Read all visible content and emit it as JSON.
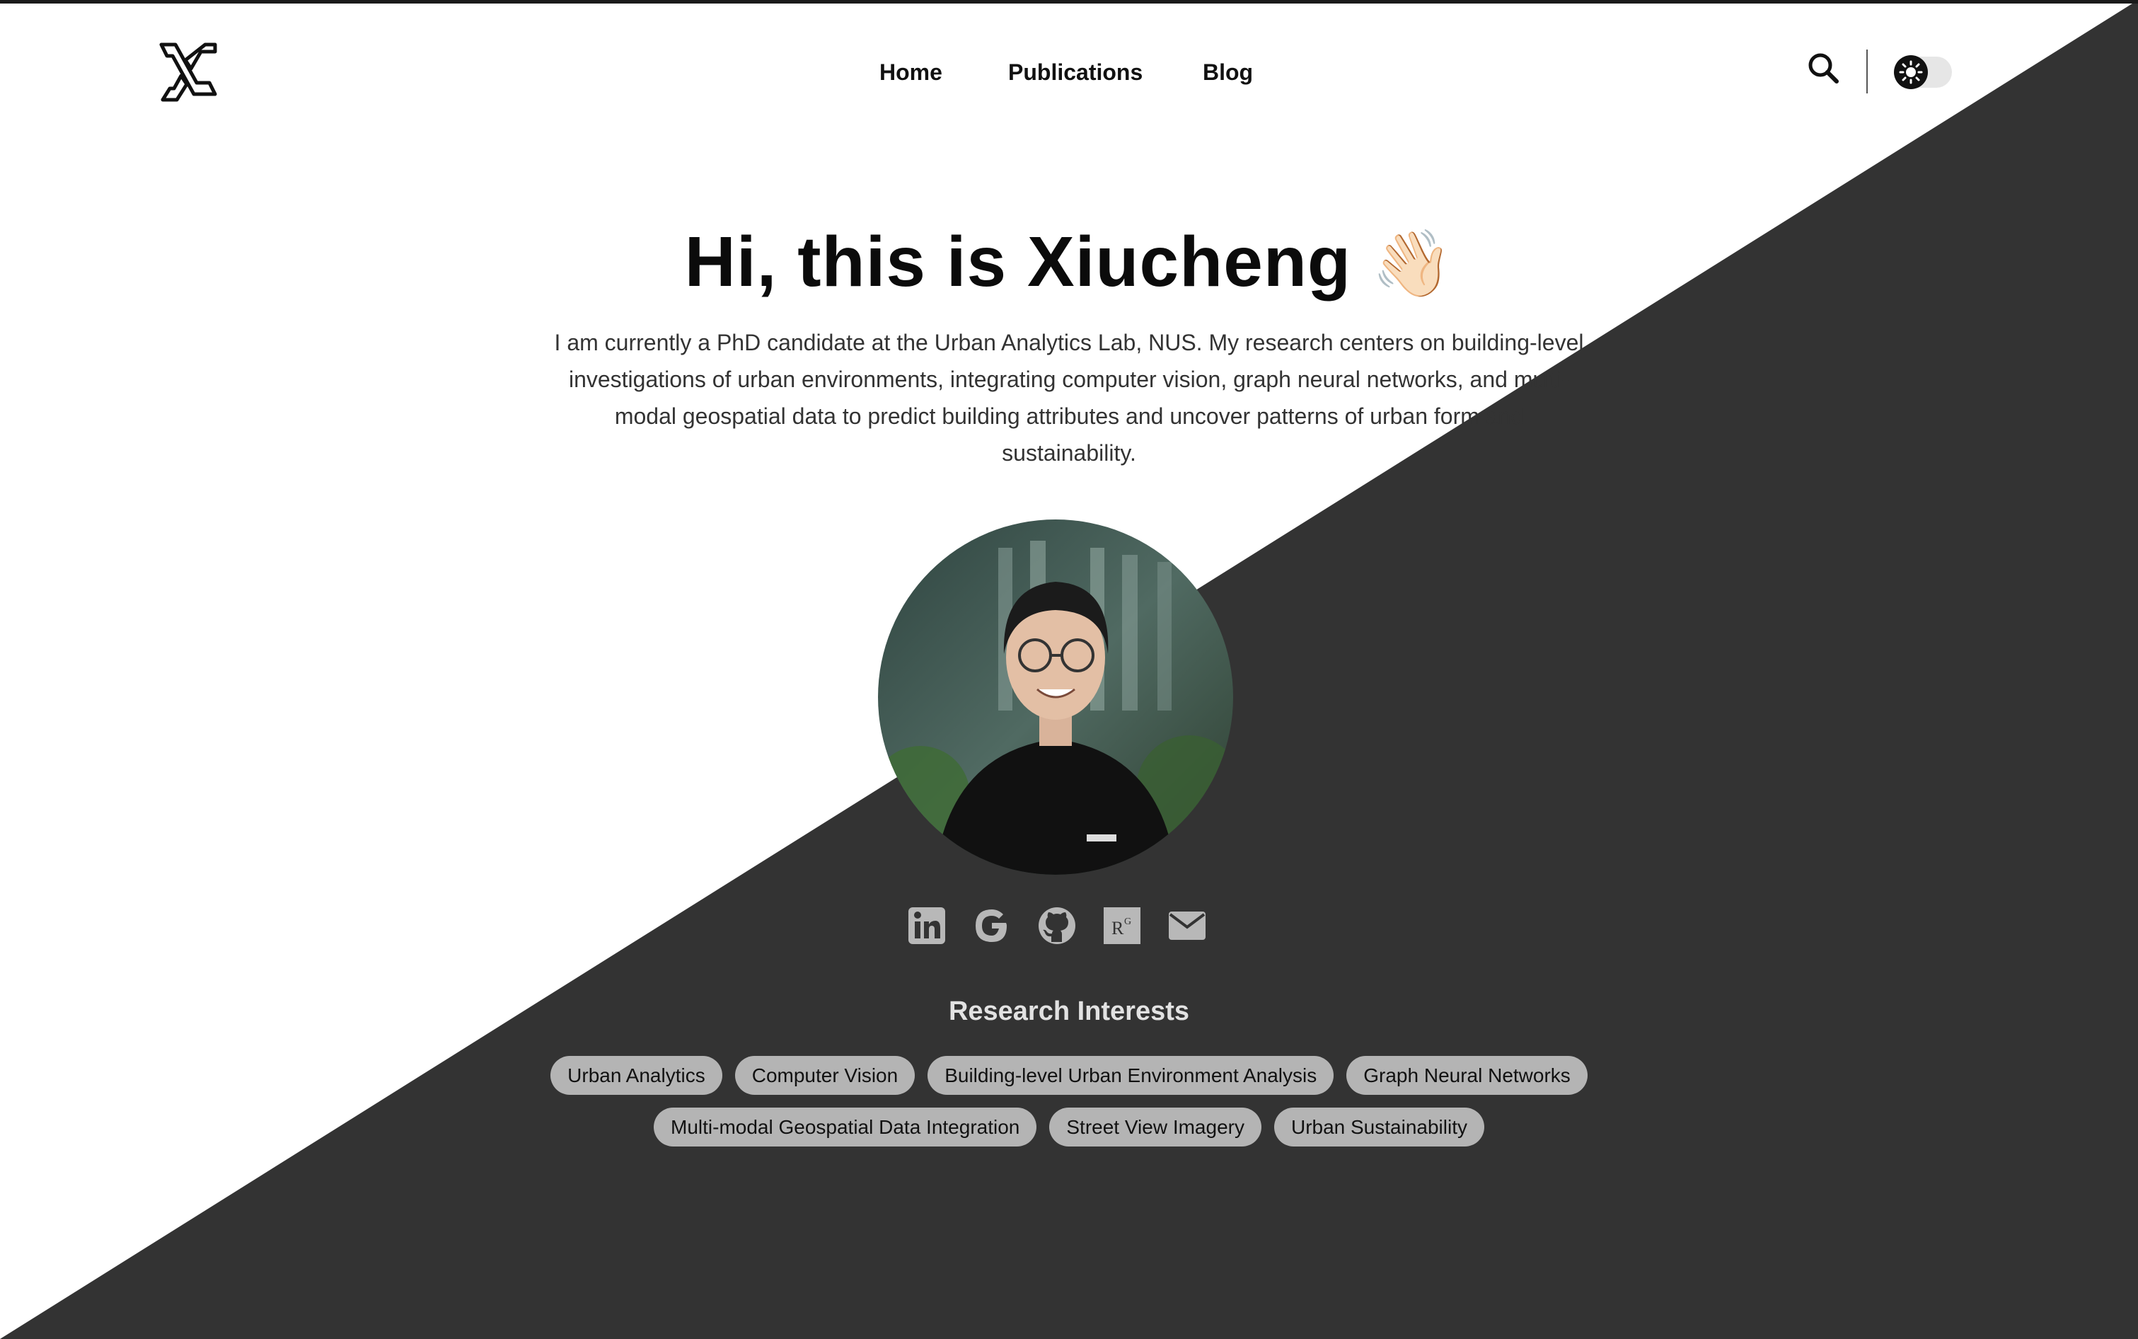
{
  "colors": {
    "background_light": "#ffffff",
    "background_dark": "#333333",
    "text_primary": "#0b0b0b",
    "tag_bg": "#b4b4b4",
    "icon_gray": "#b8b8b8"
  },
  "header": {
    "logo_icon": "xc-logo-icon",
    "nav": [
      "Home",
      "Publications",
      "Blog"
    ],
    "search_icon": "search-icon",
    "theme_toggle_icon": "sun-icon"
  },
  "hero": {
    "title": "Hi, this is Xiucheng",
    "emoji": "👋🏻",
    "bio": "I am currently a PhD candidate at the Urban Analytics Lab, NUS. My research centers on building-level investigations of urban environments, integrating computer vision, graph neural networks, and multi-modal geospatial data to predict building attributes and uncover patterns of urban form and sustainability."
  },
  "social": [
    "linkedin-icon",
    "google-scholar-icon",
    "github-icon",
    "researchgate-icon",
    "email-icon"
  ],
  "research": {
    "title": "Research Interests",
    "tags_row1": [
      "Urban Analytics",
      "Computer Vision",
      "Building-level Urban Environment Analysis",
      "Graph Neural Networks"
    ],
    "tags_row2": [
      "Multi-modal Geospatial Data Integration",
      "Street View Imagery",
      "Urban Sustainability"
    ]
  }
}
